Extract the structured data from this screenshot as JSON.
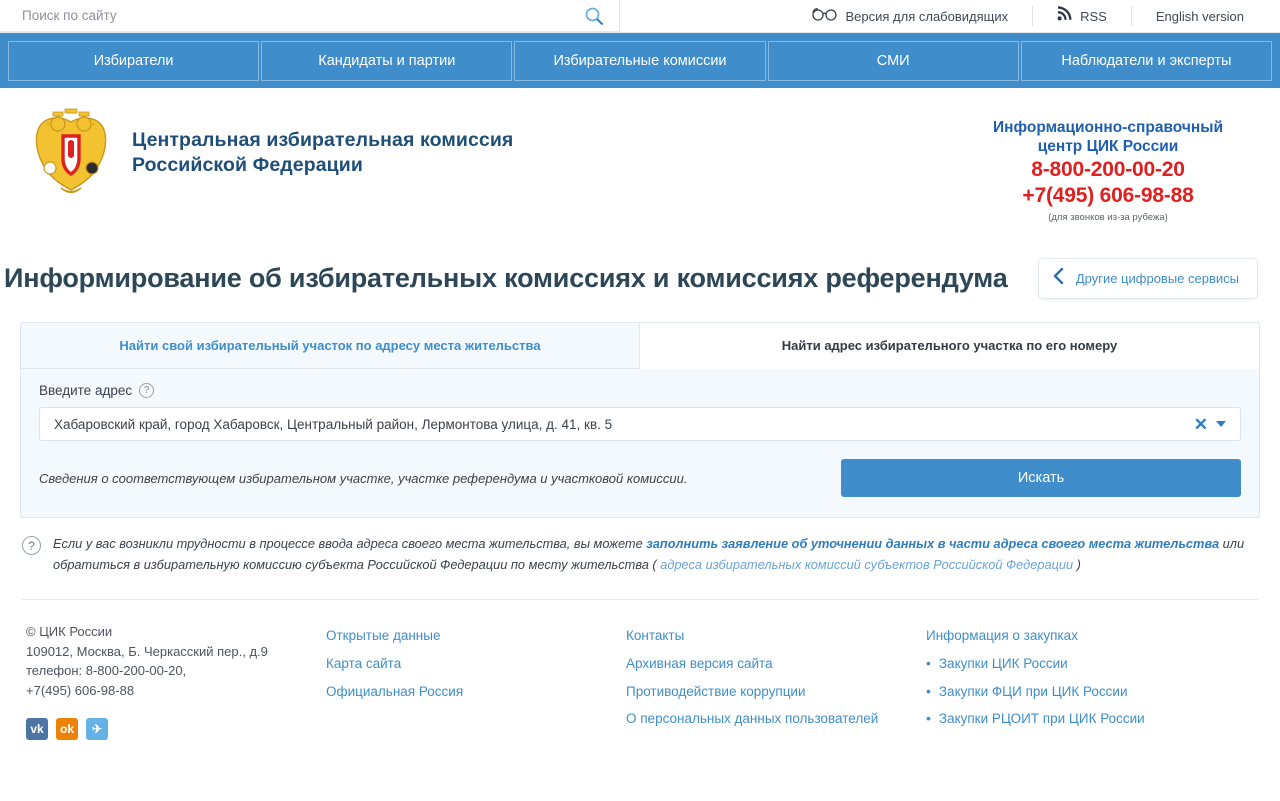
{
  "colors": {
    "brand_blue": "#3f8ecb",
    "title_dark": "#2e4756",
    "red_phone": "#e02020",
    "link_blue": "#3f8ecb",
    "panel_bg": "#f4f9fd"
  },
  "topbar": {
    "search_placeholder": "Поиск по сайту",
    "search_value": "",
    "search_icon": "search-icon",
    "accessibility_label": "Версия для слабовидящих",
    "accessibility_icon": "glasses-icon",
    "rss_label": "RSS",
    "rss_icon": "rss-icon",
    "english_label": "English version"
  },
  "mainnav": {
    "items": [
      {
        "label": "Избиратели"
      },
      {
        "label": "Кандидаты и партии"
      },
      {
        "label": "Избирательные комиссии"
      },
      {
        "label": "СМИ"
      },
      {
        "label": "Наблюдатели и эксперты"
      }
    ]
  },
  "brand": {
    "emblem_icon": "russian-coat-of-arms-icon",
    "title_line1": "Центральная избирательная комиссия",
    "title_line2": "Российской Федерации",
    "infocenter": {
      "title_line1": "Информационно-справочный",
      "title_line2": "центр ЦИК России",
      "phone1": "8-800-200-00-20",
      "phone2": "+7(495) 606-98-88",
      "note": "(для звонков из-за рубежа)"
    }
  },
  "page": {
    "title": "Информирование об избирательных комиссиях и комиссиях референдума",
    "other_services_label": "Другие цифровые сервисы",
    "other_services_icon": "chevron-left-icon"
  },
  "panel": {
    "tabs": [
      {
        "label": "Найти свой избирательный участок по адресу места жительства",
        "active": true
      },
      {
        "label": "Найти адрес избирательного участка по его номеру",
        "active": false
      }
    ],
    "field_label": "Введите адрес",
    "field_help_icon": "question-mark-icon",
    "address_value": "Хабаровский край, город Хабаровск, Центральный район, Лермонтова улица, д. 41, кв. 5",
    "address_placeholder": "Введите адрес",
    "clear_icon": "close-x-icon",
    "dropdown_icon": "caret-down-icon",
    "hint": "Сведения о соответствующем избирательном участке, участке референдума и участковой комиссии.",
    "search_button": "Искать"
  },
  "notice": {
    "icon": "question-circle-icon",
    "part1": "Если у вас возникли трудности в процессе ввода адреса своего места жительства, вы можете ",
    "link_bold": "заполнить заявление об уточнении данных в части адреса своего места жительства",
    "part2": " или обратиться в избирательную комиссию субъекта Российской Федерации по месту жительства ( ",
    "link_light": "адреса избирательных комиссий субъектов Российской Федерации",
    "part3": " )"
  },
  "footer": {
    "copyright": "© ЦИК России",
    "address": "109012, Москва, Б. Черкасский пер., д.9",
    "phone_line1": "телефон: 8-800-200-00-20,",
    "phone_line2": "+7(495) 606-98-88",
    "socials": [
      {
        "name": "vk",
        "glyph": "vk"
      },
      {
        "name": "ok",
        "glyph": "ok"
      },
      {
        "name": "telegram",
        "glyph": "✈"
      }
    ],
    "col2": [
      "Открытые данные",
      "Карта сайта",
      "Официальная Россия"
    ],
    "col3": [
      "Контакты",
      "Архивная версия сайта",
      "Противодействие коррупции",
      "О персональных данных пользователей"
    ],
    "col4_head": "Информация о закупках",
    "col4": [
      "Закупки ЦИК России",
      "Закупки ФЦИ при ЦИК России",
      "Закупки РЦОИТ при ЦИК России"
    ]
  }
}
